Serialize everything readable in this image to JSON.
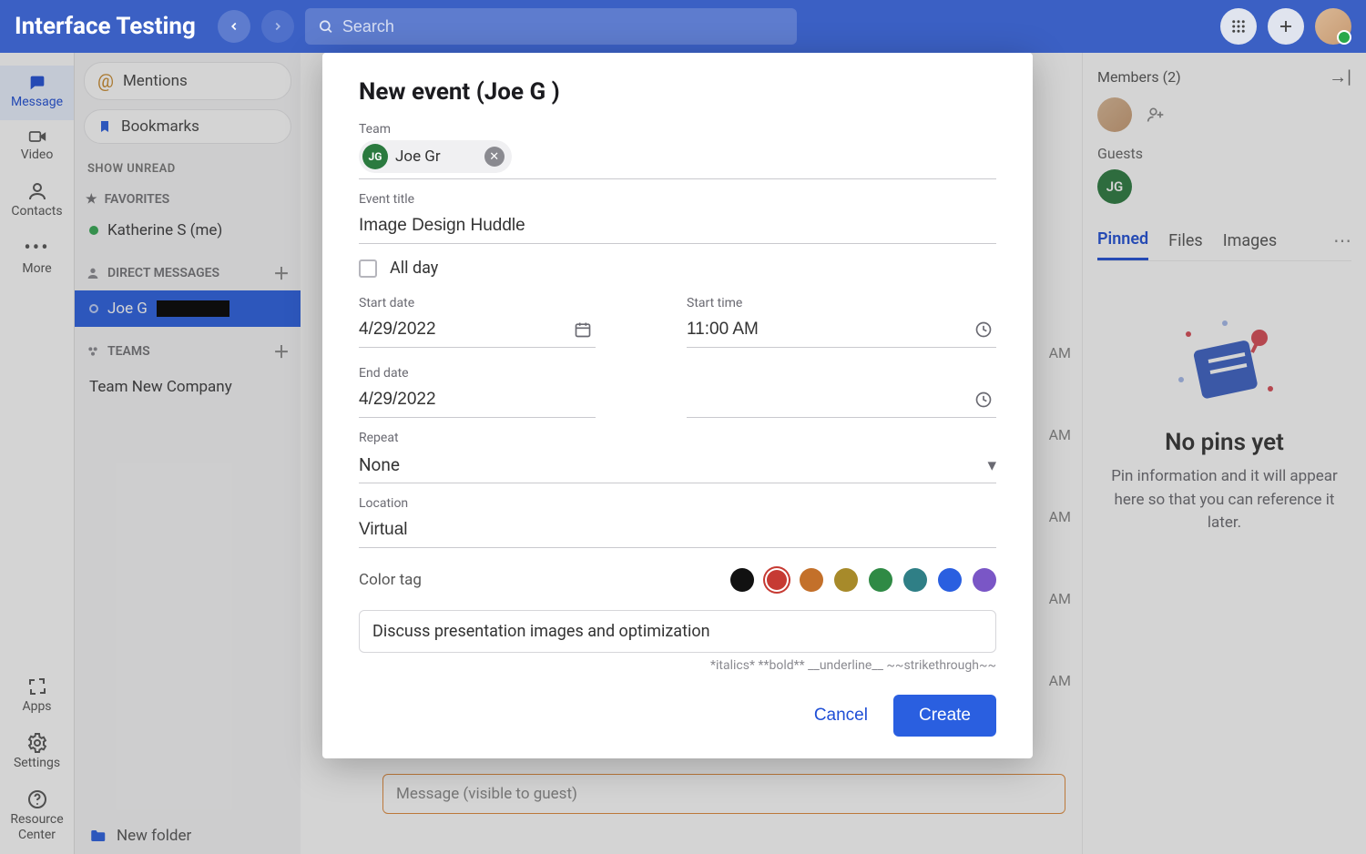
{
  "topbar": {
    "app_title": "Interface Testing",
    "search_placeholder": "Search"
  },
  "rail": {
    "message": "Message",
    "video": "Video",
    "contacts": "Contacts",
    "more": "More",
    "apps": "Apps",
    "settings": "Settings",
    "resource_center": "Resource Center"
  },
  "left": {
    "mentions": "Mentions",
    "bookmarks": "Bookmarks",
    "show_unread": "SHOW UNREAD",
    "favorites_label": "FAVORITES",
    "fav_me": "Katherine S (me)",
    "dm_label": "DIRECT MESSAGES",
    "dm_active_name": "Joe G",
    "teams_label": "TEAMS",
    "team_name": "Team New Company",
    "new_folder": "New folder"
  },
  "right": {
    "members_label": "Members (2)",
    "guests_label": "Guests",
    "guest_initials": "JG",
    "tabs": {
      "pinned": "Pinned",
      "files": "Files",
      "images": "Images"
    },
    "empty_title": "No pins yet",
    "empty_body": "Pin information and it will appear here so that you can reference it later."
  },
  "timeline": {
    "t1": "AM",
    "t2": "AM",
    "t3": "AM",
    "t4": "AM",
    "t5": "AM"
  },
  "composer": {
    "placeholder": "Message (visible to guest)"
  },
  "modal": {
    "title": "New event (Joe G            )",
    "labels": {
      "team": "Team",
      "event_title": "Event title",
      "all_day": "All day",
      "start_date": "Start date",
      "start_time": "Start time",
      "end_date": "End date",
      "repeat": "Repeat",
      "location": "Location",
      "color_tag": "Color tag"
    },
    "chip_initials": "JG",
    "chip_name": "Joe Gr",
    "event_title_value": "Image Design Huddle",
    "start_date_value": "4/29/2022",
    "start_time_value": "11:00 AM",
    "end_date_value": "4/29/2022",
    "end_time_value": "",
    "repeat_value": "None",
    "location_value": "Virtual",
    "description_value": "Discuss presentation images and optimization",
    "md_hint": "*italics* **bold** __underline__ ~~strikethrough~~",
    "cancel": "Cancel",
    "create": "Create",
    "colors": [
      "#111111",
      "#c63a33",
      "#c3702a",
      "#a78a2a",
      "#2f8a45",
      "#2f7f86",
      "#2a5fe0",
      "#7a56c6"
    ],
    "selected_color_index": 1
  }
}
